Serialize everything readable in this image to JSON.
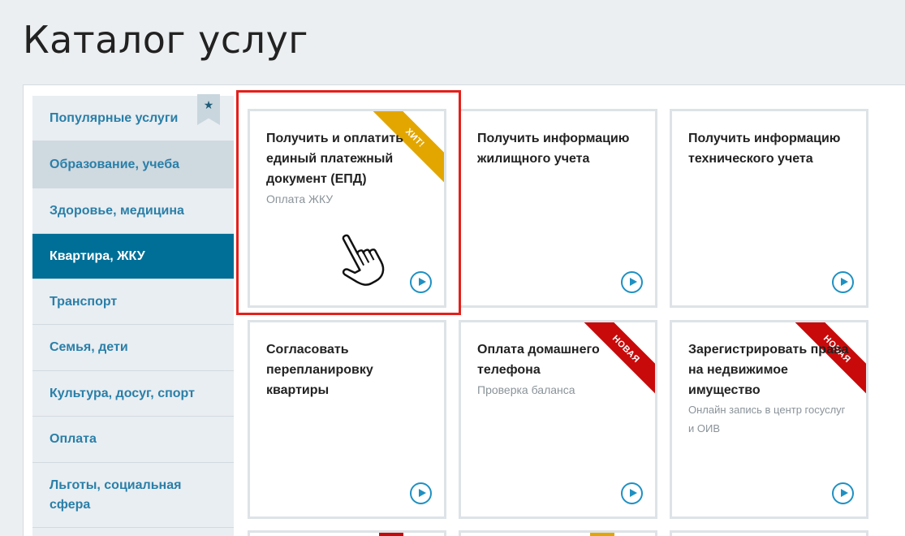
{
  "page": {
    "title": "Каталог услуг"
  },
  "sidebar": {
    "items": [
      {
        "label": "Популярные услуги",
        "state": "normal"
      },
      {
        "label": "Образование, учеба",
        "state": "alt"
      },
      {
        "label": "Здоровье, медицина",
        "state": "normal"
      },
      {
        "label": "Квартира, ЖКУ",
        "state": "active"
      },
      {
        "label": "Транспорт",
        "state": "normal"
      },
      {
        "label": "Семья, дети",
        "state": "normal"
      },
      {
        "label": "Культура, досуг, спорт",
        "state": "normal"
      },
      {
        "label": "Оплата",
        "state": "normal"
      },
      {
        "label": "Льготы, социальная сфера",
        "state": "normal"
      }
    ],
    "bookmark_icon": "star-icon"
  },
  "cards": [
    {
      "title": "Получить и оплатить единый платежный документ (ЕПД)",
      "subtitle": "Оплата ЖКУ",
      "ribbon": "ХИТ!"
    },
    {
      "title": "Получить информацию жилищного учета",
      "subtitle": "",
      "ribbon": ""
    },
    {
      "title": "Получить информацию технического учета",
      "subtitle": "",
      "ribbon": ""
    },
    {
      "title": "Согласовать перепланировку квартиры",
      "subtitle": "",
      "ribbon": ""
    },
    {
      "title": "Оплата домашнего телефона",
      "subtitle": "Проверка баланса",
      "ribbon": "НОВАЯ"
    },
    {
      "title": "Зарегистрировать права на недвижимое имущество",
      "subtitle": "Онлайн запись в центр госуслуг и ОИВ",
      "ribbon": "НОВАЯ"
    }
  ],
  "colors": {
    "accent": "#006f97",
    "link": "#2a7fa8",
    "hit_ribbon": "#e3a600",
    "new_ribbon": "#c90a0a",
    "highlight": "#e3201b",
    "play": "#1f90c2"
  },
  "icons": {
    "play": "play-circle-icon",
    "cursor": "hand-pointer-icon"
  }
}
